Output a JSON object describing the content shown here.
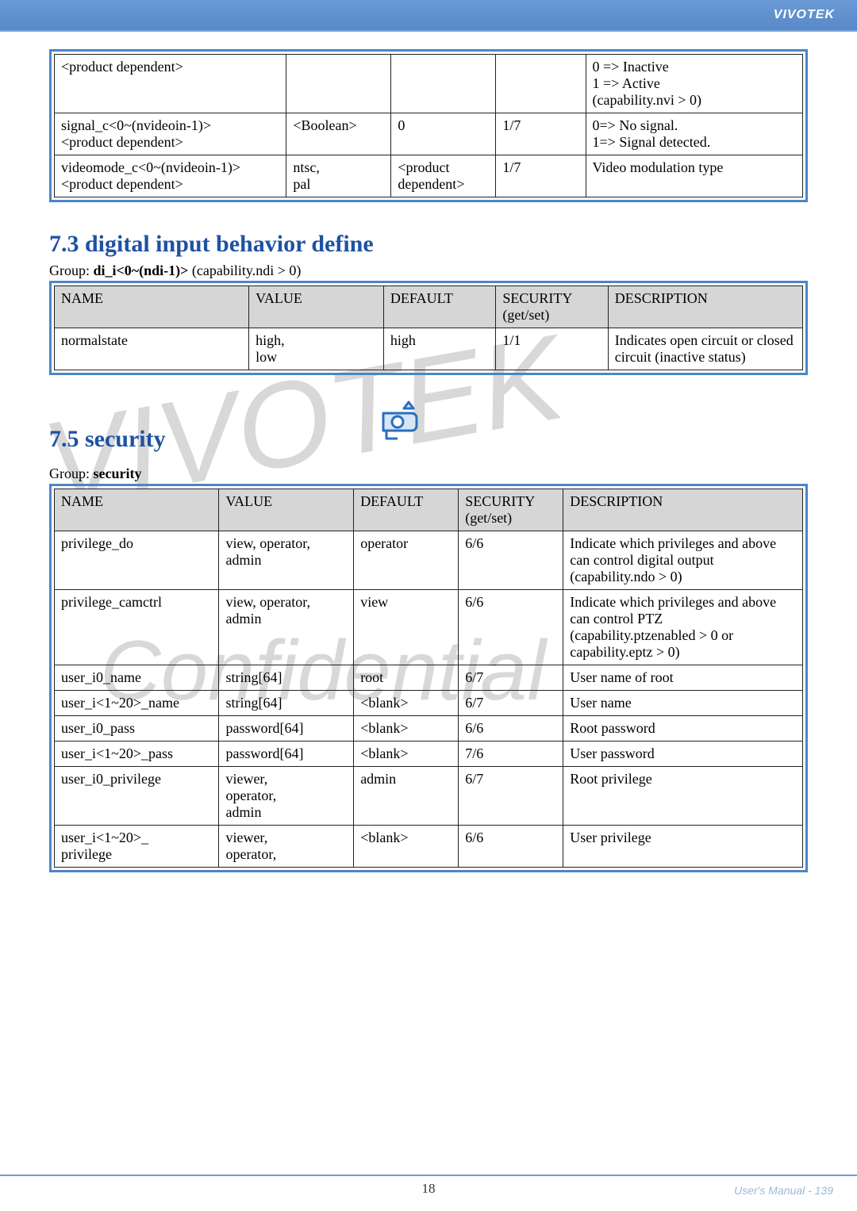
{
  "brand": "VIVOTEK",
  "footer": {
    "page": "18",
    "manual": "User's Manual - 139"
  },
  "table1": {
    "rows": [
      {
        "name": "<product dependent>",
        "value": "",
        "default": "",
        "security": "",
        "desc": "0 => Inactive\n1 => Active\n(capability.nvi > 0)"
      },
      {
        "name": "signal_c<0~(nvideoin-1)>\n<product dependent>",
        "value": "<Boolean>",
        "default": "0",
        "security": "1/7",
        "desc": "0=> No signal.\n1=> Signal detected."
      },
      {
        "name": "videomode_c<0~(nvideoin-1)>\n<product dependent>",
        "value": "ntsc,\npal",
        "default": "<product\ndependent>",
        "security": "1/7",
        "desc": "Video modulation type"
      }
    ]
  },
  "section73": {
    "title": "7.3 digital input behavior define",
    "group_prefix": "Group: ",
    "group_bold": "di_i<0~(ndi-1)>",
    "group_suffix": " (capability.ndi > 0)"
  },
  "table2": {
    "headers": [
      "NAME",
      "VALUE",
      "DEFAULT",
      "SECURITY\n(get/set)",
      "DESCRIPTION"
    ],
    "rows": [
      {
        "name": "normalstate",
        "value": "high,\nlow",
        "default": "high",
        "security": "1/1",
        "desc": "Indicates open circuit or closed circuit (inactive status)"
      }
    ]
  },
  "section75": {
    "title": "7.5 security",
    "group_prefix": "Group: ",
    "group_bold": "security"
  },
  "table3": {
    "headers": [
      "NAME",
      "VALUE",
      "DEFAULT",
      "SECURITY\n(get/set)",
      "DESCRIPTION"
    ],
    "rows": [
      {
        "name": "privilege_do",
        "value": "view, operator,\nadmin",
        "default": "operator",
        "security": "6/6",
        "desc": "Indicate which privileges and above can control digital output\n(capability.ndo > 0)"
      },
      {
        "name": "privilege_camctrl",
        "value": "view, operator,\nadmin",
        "default": "view",
        "security": "6/6",
        "desc": "Indicate which privileges and above can control PTZ\n(capability.ptzenabled > 0 or capability.eptz > 0)"
      },
      {
        "name": "user_i0_name",
        "value": "string[64]",
        "default": "root",
        "security": "6/7",
        "desc": "User name of root"
      },
      {
        "name": "user_i<1~20>_name",
        "value": "string[64]",
        "default": "<blank>",
        "security": "6/7",
        "desc": "User name"
      },
      {
        "name": "user_i0_pass",
        "value": "password[64]",
        "default": "<blank>",
        "security": "6/6",
        "desc": "Root password"
      },
      {
        "name": "user_i<1~20>_pass",
        "value": "password[64]",
        "default": "<blank>",
        "security": "7/6",
        "desc": "User password"
      },
      {
        "name": "user_i0_privilege",
        "value": "viewer,\noperator,\nadmin",
        "default": "admin",
        "security": "6/7",
        "desc": "Root privilege"
      },
      {
        "name": "user_i<1~20>_\nprivilege",
        "value": "viewer,\noperator,",
        "default": "<blank>",
        "security": "6/6",
        "desc": "User privilege"
      }
    ]
  }
}
